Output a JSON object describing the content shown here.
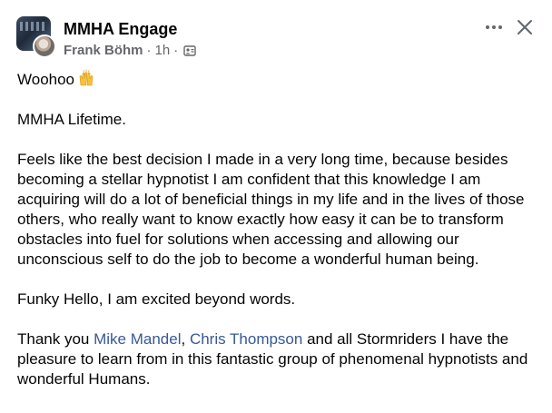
{
  "post": {
    "group_name": "MMHA Engage",
    "author": "Frank Böhm",
    "time": "1h",
    "separator": "·",
    "audience_icon": "group-audience-icon",
    "more_icon": "more-options-icon",
    "close_icon": "close-icon"
  },
  "content": {
    "line1_text": "Woohoo",
    "line1_emoji": "raising-hands-emoji",
    "line2": "MMHA Lifetime.",
    "paragraph3": "Feels like the best decision I made in a very long time, because besides becoming a stellar hypnotist I am confident that this knowledge I am acquiring will do a lot of beneficial things in my life and in the lives of those others, who really want to know exactly how easy it can be to transform obstacles into fuel for solutions when accessing and allowing our unconscious self to do the job to become a wonderful human being.",
    "paragraph4": "Funky Hello, I am excited beyond words.",
    "thanks_prefix": "Thank you ",
    "mention1": "Mike Mandel",
    "comma": ", ",
    "mention2": "Chris Thompson",
    "thanks_suffix": " and all Stormriders I have the pleasure to learn from in this fantastic group of phenomenal hypnotists and wonderful Humans."
  },
  "colors": {
    "mention": "#385898",
    "meta": "#65676b",
    "text": "#050505"
  }
}
